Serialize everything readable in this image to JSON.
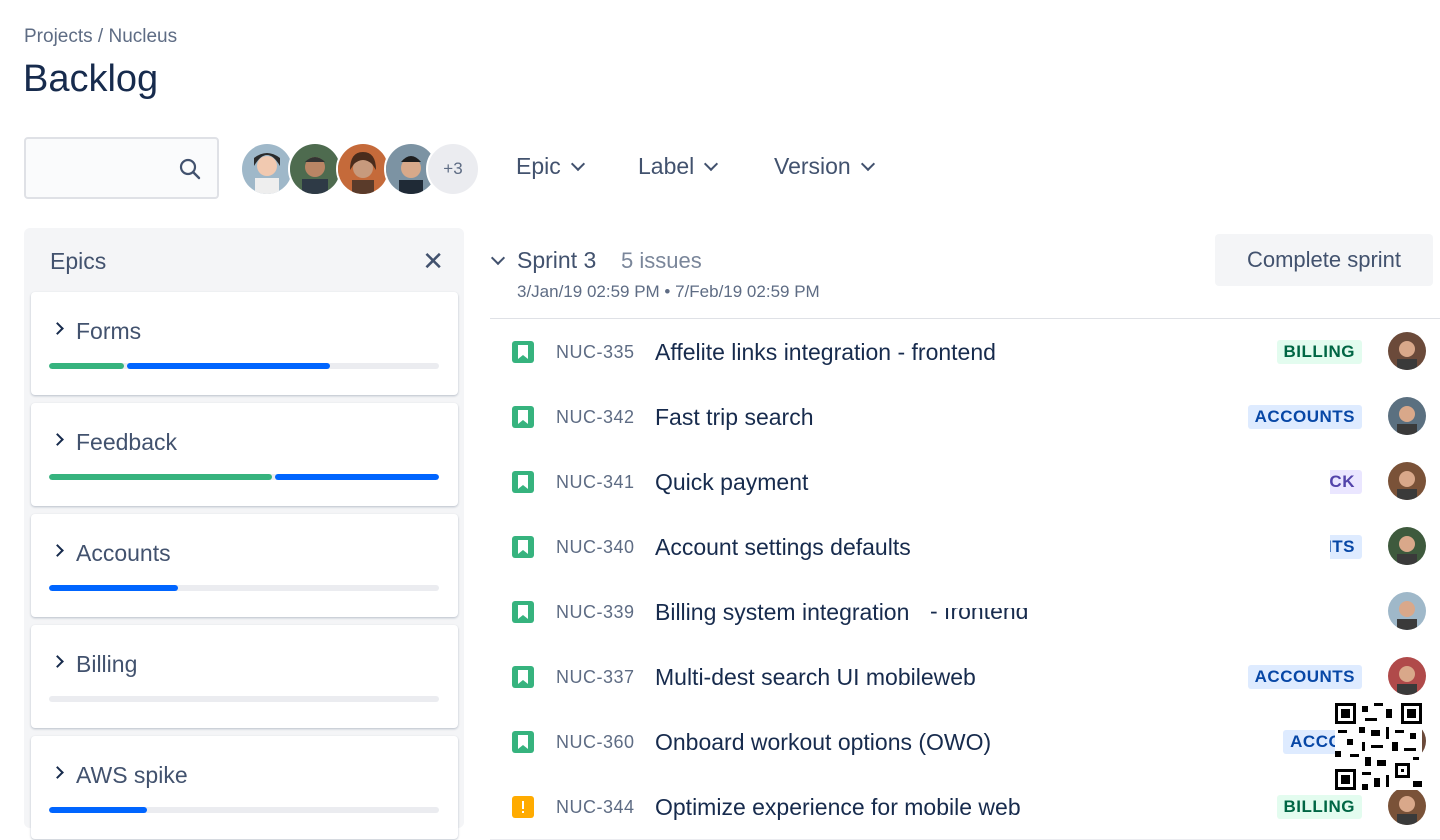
{
  "breadcrumb": "Projects / Nucleus",
  "page_title": "Backlog",
  "search": {
    "placeholder": ""
  },
  "avatars_more": "+3",
  "filters": [
    "Epic",
    "Label",
    "Version"
  ],
  "epics_panel": {
    "title": "Epics",
    "close": "✕",
    "items": [
      {
        "name": "Forms",
        "progress_green": 0.2,
        "progress_blue": 0.52
      },
      {
        "name": "Feedback",
        "progress_green": 0.58,
        "progress_blue": 0.42
      },
      {
        "name": "Accounts",
        "progress_green": 0,
        "progress_blue": 0.33
      },
      {
        "name": "Billing",
        "progress_green": 0,
        "progress_blue": 0
      },
      {
        "name": "AWS spike",
        "progress_green": 0,
        "progress_blue": 0.25
      }
    ]
  },
  "sprint": {
    "name": "Sprint 3",
    "count": "5 issues",
    "dates": "3/Jan/19 02:59 PM • 7/Feb/19 02:59 PM",
    "complete_label": "Complete sprint"
  },
  "issues": [
    {
      "key": "NUC-335",
      "summary": "Affelite links integration - frontend",
      "label": "BILLING",
      "label_style": "billing",
      "type": "story"
    },
    {
      "key": "NUC-342",
      "summary": "Fast trip search",
      "label": "ACCOUNTS",
      "label_style": "accounts",
      "type": "story"
    },
    {
      "key": "NUC-341",
      "summary": "Quick payment",
      "label": "ACK",
      "label_style": "purple",
      "type": "story"
    },
    {
      "key": "NUC-340",
      "summary": "Account settings defaults",
      "label": "NTS",
      "label_style": "accounts",
      "type": "story"
    },
    {
      "key": "NUC-339",
      "summary": "Billing system integration",
      "label": "",
      "label_style": "",
      "type": "story"
    },
    {
      "key": "NUC-337",
      "summary": "Multi-dest search UI mobileweb",
      "label": "ACCOUNTS",
      "label_style": "accounts",
      "type": "story"
    },
    {
      "key": "NUC-360",
      "summary": "Onboard workout options (OWO)",
      "label": "ACCOU",
      "label_style": "accounts",
      "type": "story"
    },
    {
      "key": "NUC-344",
      "summary": "Optimize experience for mobile web",
      "label": "BILLING",
      "label_style": "billing",
      "type": "bug"
    }
  ],
  "peek_text": "- frontend",
  "colors": {
    "green": "#36b37e",
    "blue": "#0065ff",
    "track": "#ebecf0"
  }
}
